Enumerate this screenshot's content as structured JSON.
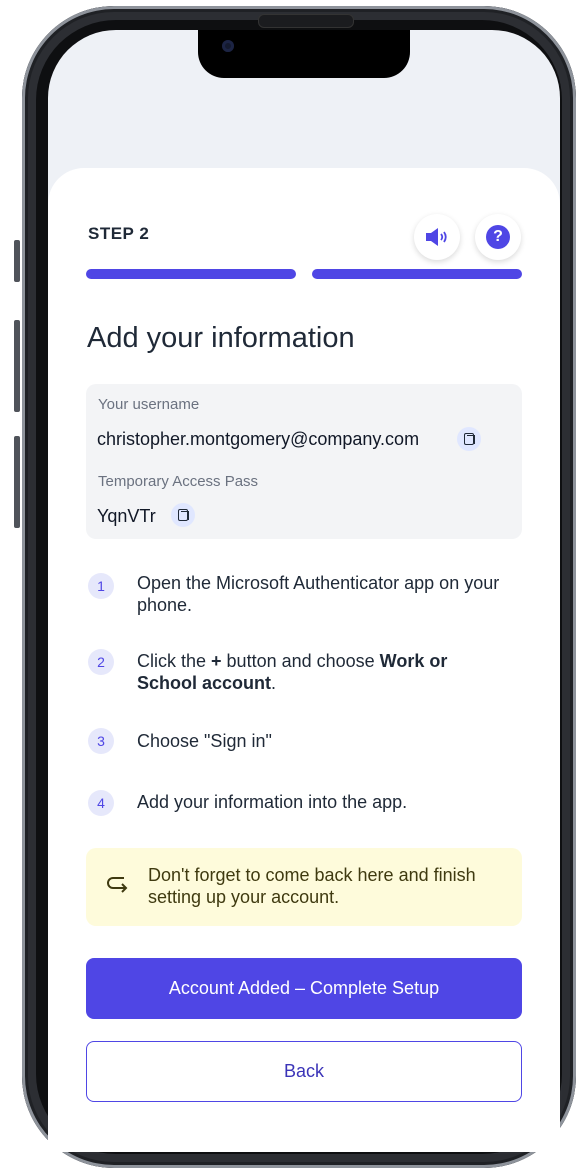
{
  "step": {
    "label": "STEP 2",
    "progress_total": 2,
    "progress_current": 2
  },
  "header": {
    "title": "Add your information",
    "audio_icon": "speaker-icon",
    "help_icon": "help-icon",
    "help_glyph": "?"
  },
  "info": {
    "username_label": "Your username",
    "username_value": "christopher.montgomery@company.com",
    "tap_label": "Temporary Access Pass",
    "tap_value": "YqnVTr"
  },
  "instructions": [
    {
      "num": "1",
      "text": "Open the Microsoft Authenticator app on your phone."
    },
    {
      "num": "2",
      "pre": "Click the ",
      "plus": "+",
      "mid": " button and choose ",
      "bold": "Work or School account",
      "post": "."
    },
    {
      "num": "3",
      "text": "Choose \"Sign in\""
    },
    {
      "num": "4",
      "text": "Add your information into the app."
    }
  ],
  "tip": {
    "text": "Don't forget to come back here and finish setting up your account.",
    "icon": "return-arrow-icon"
  },
  "buttons": {
    "primary": "Account Added – Complete Setup",
    "secondary": "Back"
  },
  "colors": {
    "accent": "#4f46e5",
    "tip_bg": "#fefbdb",
    "info_bg": "#f3f4f6"
  }
}
